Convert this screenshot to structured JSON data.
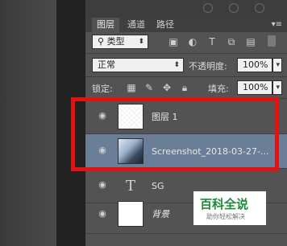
{
  "tabs": [
    "图层",
    "通道",
    "路径"
  ],
  "filter": {
    "kind_label": "类型"
  },
  "blend": {
    "mode": "正常",
    "opacity_label": "不透明度:",
    "opacity_value": "100%"
  },
  "lock": {
    "label": "锁定:",
    "fill_label": "填充:",
    "fill_value": "100%"
  },
  "layers": [
    {
      "name": "图层 1"
    },
    {
      "name": "Screenshot_2018-03-27-..."
    },
    {
      "name": "SG"
    },
    {
      "name": "背景"
    }
  ],
  "watermark": {
    "title": "百科全说",
    "subtitle": "助你轻松解决"
  },
  "colors": {
    "highlight": "#e11212",
    "selected_row": "#6b7e97",
    "brand": "#1f8a3a"
  }
}
